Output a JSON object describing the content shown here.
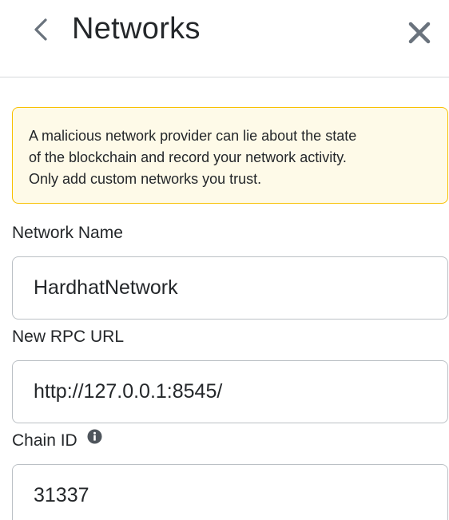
{
  "header": {
    "title": "Networks",
    "back_icon": "chevron-left-icon",
    "close_icon": "close-icon"
  },
  "warning": {
    "lines": [
      "A malicious network provider can lie about the state",
      "of the blockchain and record your network activity.",
      "Only add custom networks you trust."
    ],
    "background": "#fefae8",
    "border": "#f8c000"
  },
  "fields": {
    "network_name": {
      "label": "Network Name",
      "value": "HardhatNetwork"
    },
    "rpc_url": {
      "label": "New RPC URL",
      "value": "http://127.0.0.1:8545/"
    },
    "chain_id": {
      "label": "Chain ID",
      "info_icon": "info-icon",
      "value": "31337"
    }
  }
}
